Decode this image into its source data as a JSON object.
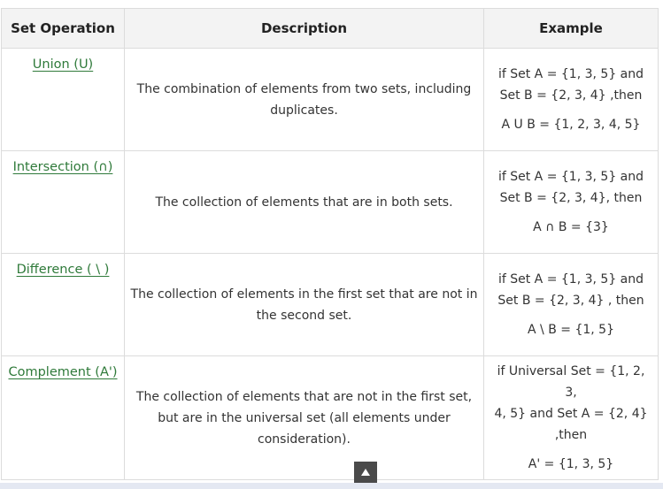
{
  "table": {
    "headers": [
      "Set Operation",
      "Description",
      "Example"
    ],
    "rows": [
      {
        "operation": "Union (U)",
        "description": "The combination of elements from two sets, including duplicates.",
        "example_lines": [
          "if Set A = {1, 3, 5} and",
          "Set B = {2, 3, 4} ,then"
        ],
        "example_result": "A U B = {1, 2, 3, 4, 5}"
      },
      {
        "operation": "Intersection (∩)",
        "description": "The collection of elements that are in both sets.",
        "example_lines": [
          "if Set A = {1, 3, 5} and",
          "Set B = {2, 3, 4}, then"
        ],
        "example_result": "A ∩ B = {3}"
      },
      {
        "operation": "Difference ( \\ )",
        "description": "The collection of elements in the first set that are not in the second set.",
        "example_lines": [
          "if Set A = {1, 3, 5} and",
          "Set B = {2, 3, 4} , then"
        ],
        "example_result": "A \\ B = {1, 5}"
      },
      {
        "operation": "Complement (A')",
        "description": "The collection of elements that are not in the first set, but are in the universal set (all elements under consideration).",
        "example_lines": [
          "if Universal Set = {1, 2, 3,",
          "4, 5} and Set A = {2, 4}",
          ",then"
        ],
        "example_result": "A' = {1, 3, 5}"
      }
    ]
  },
  "scroll_top_icon": "triangle-up-icon"
}
